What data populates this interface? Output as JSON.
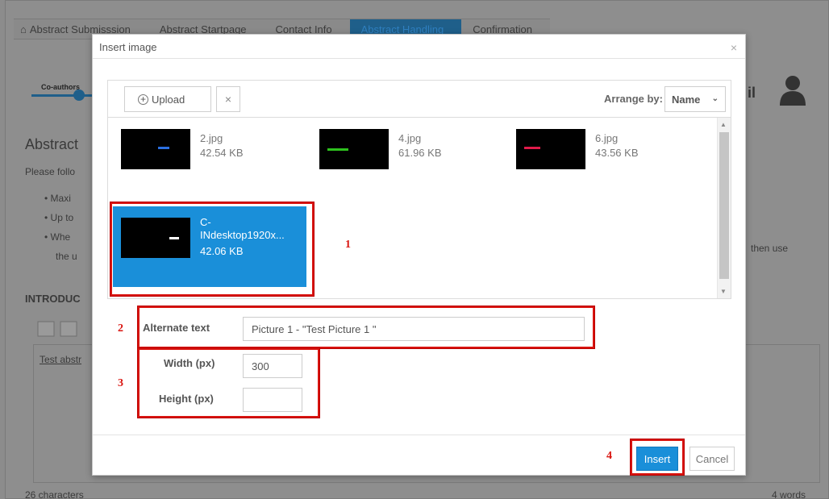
{
  "background": {
    "wizard_steps": [
      "Abstract Submisssion",
      "Abstract Startpage",
      "Contact Info",
      "Abstract Handling",
      "Confirmation"
    ],
    "coauthors_label": "Co-authors",
    "right_word_fragment": "il",
    "abstract_heading_fragment": "Abstract",
    "please_fragment": "Please follo",
    "bullet_fragments": [
      "Maxi",
      "Up to",
      "Whe",
      "the u"
    ],
    "then_use_fragment": "then use",
    "intro_fragment": "INTRODUC",
    "editor_text_fragment": "Test abstr",
    "char_count": "26 characters",
    "word_count": "4 words"
  },
  "modal": {
    "title": "Insert image",
    "close_glyph": "×",
    "upload_label": "Upload",
    "clear_glyph": "×",
    "arrange_label": "Arrange by:",
    "arrange_value": "Name"
  },
  "files": [
    {
      "name": "2.jpg",
      "size": "42.54 KB",
      "mark_color": "#2b6fe0",
      "mark_label": "C·IN",
      "selected": false
    },
    {
      "name": "4.jpg",
      "size": "61.96 KB",
      "mark_color": "#2ec21e",
      "mark_label": "C·IN",
      "selected": false
    },
    {
      "name": "6.jpg",
      "size": "43.56 KB",
      "mark_color": "#e01b4a",
      "mark_label": "C·IN",
      "selected": false
    },
    {
      "name_line1": "C-",
      "name_line2": "INdesktop1920x...",
      "size": "42.06 KB",
      "mark_color": "#ffffff",
      "mark_label": "C·IN",
      "selected": true
    }
  ],
  "form": {
    "alt_label": "Alternate text",
    "alt_value": "Picture 1 - \"Test Picture 1 \"",
    "width_label": "Width (px)",
    "width_value": "300",
    "height_label": "Height (px)",
    "height_value": ""
  },
  "footer": {
    "insert_label": "Insert",
    "cancel_label": "Cancel"
  },
  "annotations": [
    "1",
    "2",
    "3",
    "4"
  ],
  "colors": {
    "accent": "#1a8fd9",
    "annotation": "#d9140f"
  }
}
